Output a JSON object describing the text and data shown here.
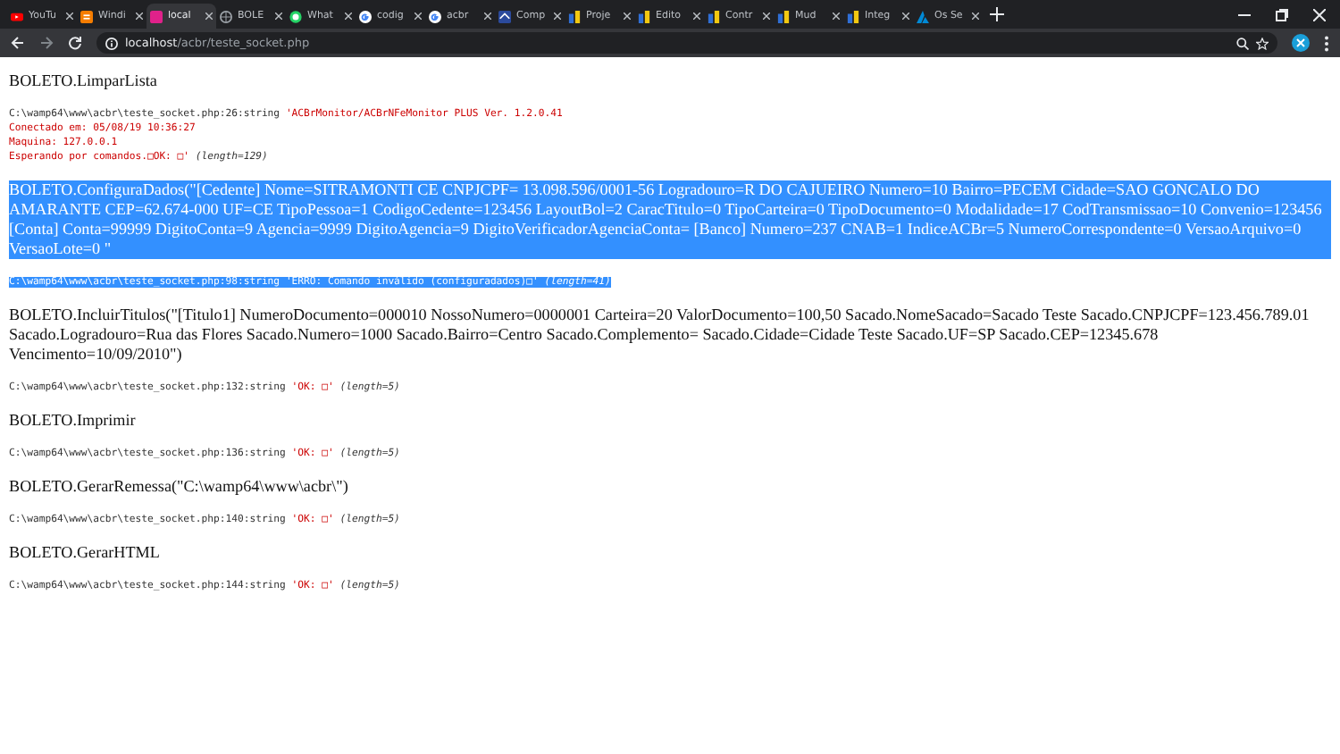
{
  "tabs": [
    {
      "title": "YouTu",
      "kind": "youtube",
      "selected": false
    },
    {
      "title": "Windi",
      "kind": "blogger",
      "selected": false
    },
    {
      "title": "local",
      "kind": "magenta",
      "selected": true
    },
    {
      "title": "BOLE",
      "kind": "globe",
      "selected": false
    },
    {
      "title": "What",
      "kind": "whatsapp",
      "selected": false
    },
    {
      "title": "codig",
      "kind": "google",
      "selected": false
    },
    {
      "title": "acbr",
      "kind": "google",
      "selected": false
    },
    {
      "title": "Comp",
      "kind": "navy",
      "selected": false
    },
    {
      "title": "Proje",
      "kind": "board",
      "selected": false
    },
    {
      "title": "Edito",
      "kind": "board",
      "selected": false
    },
    {
      "title": "Contr",
      "kind": "board",
      "selected": false
    },
    {
      "title": "Mud",
      "kind": "board",
      "selected": false
    },
    {
      "title": "Integ",
      "kind": "board",
      "selected": false
    },
    {
      "title": "Os Se",
      "kind": "azure",
      "selected": false
    }
  ],
  "address": {
    "host": "localhost",
    "path": "/acbr/teste_socket.php"
  },
  "entries": [
    {
      "command": "BOLETO.LimparLista",
      "selected": false,
      "dump": {
        "location": "C:\\wamp64\\www\\acbr\\teste_socket.php:26:string",
        "lines": [
          "'ACBrMonitor/ACBrNFeMonitor PLUS Ver. 1.2.0.41",
          "Conectado em: 05/08/19 10:36:27",
          "Maquina: 127.0.0.1",
          "Esperando por comandos.□OK: □'"
        ],
        "length": "(length=129)"
      }
    },
    {
      "command": "BOLETO.ConfiguraDados(\"[Cedente] Nome=SITRAMONTI CE CNPJCPF= 13.098.596/0001-56 Logradouro=R DO CAJUEIRO Numero=10 Bairro=PECEM Cidade=SAO GONCALO DO AMARANTE CEP=62.674-000 UF=CE TipoPessoa=1 CodigoCedente=123456 LayoutBol=2 CaracTitulo=0 TipoCarteira=0 TipoDocumento=0 Modalidade=17 CodTransmissao=10 Convenio=123456 [Conta] Conta=99999 DigitoConta=9 Agencia=9999 DigitoAgencia=9 DigitoVerificadorAgenciaConta= [Banco] Numero=237 CNAB=1 IndiceACBr=5 NumeroCorrespondente=0 VersaoArquivo=0 VersaoLote=0 \"",
      "selected": true,
      "dump": {
        "location": "C:\\wamp64\\www\\acbr\\teste_socket.php:98:string",
        "lines": [
          "'ERRO: Comando inválido (configuradados)□'"
        ],
        "length": "(length=41)"
      }
    },
    {
      "command": "BOLETO.IncluirTitulos(\"[Titulo1] NumeroDocumento=000010 NossoNumero=0000001 Carteira=20 ValorDocumento=100,50 Sacado.NomeSacado=Sacado Teste Sacado.CNPJCPF=123.456.789.01 Sacado.Logradouro=Rua das Flores Sacado.Numero=1000 Sacado.Bairro=Centro Sacado.Complemento= Sacado.Cidade=Cidade Teste Sacado.UF=SP Sacado.CEP=12345.678 Vencimento=10/09/2010\")",
      "selected": false,
      "dump": {
        "location": "C:\\wamp64\\www\\acbr\\teste_socket.php:132:string",
        "lines": [
          "'OK: □'"
        ],
        "length": "(length=5)"
      }
    },
    {
      "command": "BOLETO.Imprimir",
      "selected": false,
      "dump": {
        "location": "C:\\wamp64\\www\\acbr\\teste_socket.php:136:string",
        "lines": [
          "'OK: □'"
        ],
        "length": "(length=5)"
      }
    },
    {
      "command": "BOLETO.GerarRemessa(\"C:\\wamp64\\www\\acbr\\\")",
      "selected": false,
      "dump": {
        "location": "C:\\wamp64\\www\\acbr\\teste_socket.php:140:string",
        "lines": [
          "'OK: □'"
        ],
        "length": "(length=5)"
      }
    },
    {
      "command": "BOLETO.GerarHTML",
      "selected": false,
      "dump": {
        "location": "C:\\wamp64\\www\\acbr\\teste_socket.php:144:string",
        "lines": [
          "'OK: □'"
        ],
        "length": "(length=5)"
      }
    }
  ]
}
